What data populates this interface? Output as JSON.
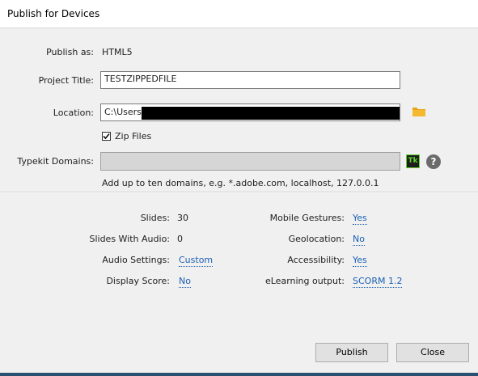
{
  "window": {
    "title": "Publish for Devices"
  },
  "form": {
    "publish_as_label": "Publish as:",
    "publish_as_value": "HTML5",
    "project_title_label": "Project Title:",
    "project_title_value": "TESTZIPPEDFILE",
    "location_label": "Location:",
    "location_value": "C:\\Users",
    "zip_files_label": "Zip Files",
    "zip_files_checked": true,
    "typekit_label": "Typekit Domains:",
    "typekit_value": "",
    "typekit_hint": "Add up to ten domains, e.g. *.adobe.com, localhost, 127.0.0.1",
    "typekit_icon_text": "Tk",
    "help_icon_text": "?"
  },
  "summary": {
    "left": [
      {
        "label": "Slides:",
        "value": "30",
        "link": false
      },
      {
        "label": "Slides With Audio:",
        "value": "0",
        "link": false
      },
      {
        "label": "Audio Settings:",
        "value": "Custom",
        "link": true
      },
      {
        "label": "Display Score:",
        "value": "No",
        "link": true
      }
    ],
    "right": [
      {
        "label": "Mobile Gestures:",
        "value": "Yes",
        "link": true
      },
      {
        "label": "Geolocation:",
        "value": "No",
        "link": true
      },
      {
        "label": "Accessibility:",
        "value": "Yes",
        "link": true
      },
      {
        "label": "eLearning output:",
        "value": "SCORM 1.2",
        "link": true
      }
    ]
  },
  "buttons": {
    "publish": "Publish",
    "close": "Close"
  },
  "colors": {
    "link": "#1a5fb4",
    "folder": "#e8a317",
    "typekit_bg": "#1d1d1d",
    "typekit_fg": "#62d12d"
  },
  "icons": {
    "folder": "folder-icon",
    "typekit": "typekit-icon",
    "help": "help-icon",
    "check": "check-icon"
  }
}
